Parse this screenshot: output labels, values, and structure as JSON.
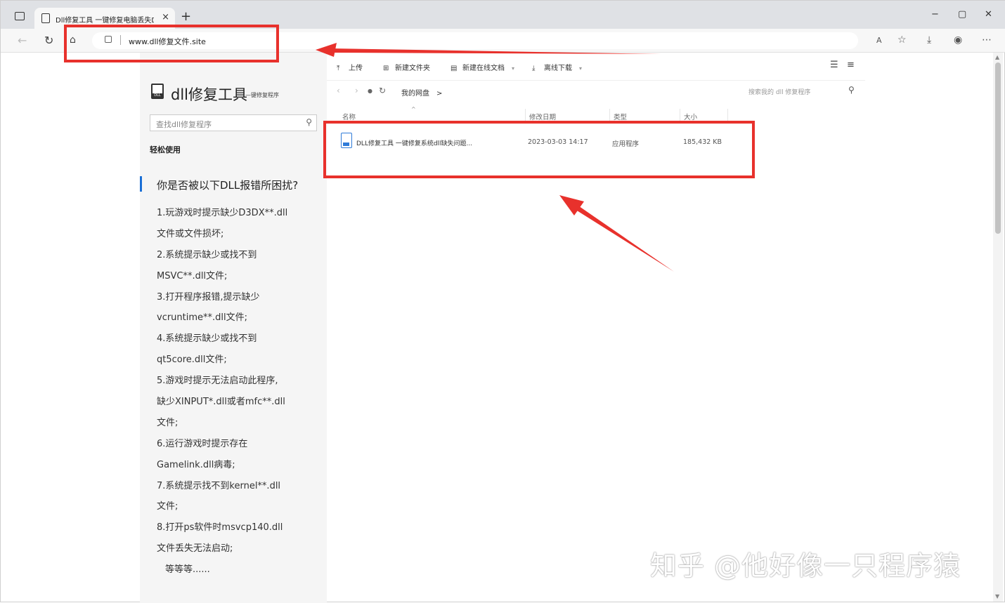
{
  "browser": {
    "tab_title": "Dll修复工具 一键修复电脑丢失D",
    "tab_close": "×",
    "new_tab": "+",
    "url": "www.dll修复文件.site",
    "window_controls": {
      "minimize": "−",
      "maximize": "▢",
      "close": "✕"
    }
  },
  "sidebar": {
    "logo_title": "dll修复工具",
    "logo_subtitle": "—键修复程序",
    "search_placeholder": "查找dll修复程序",
    "easy_use": "轻松使用",
    "heading": "你是否被以下DLL报错所困扰?",
    "lines": [
      "1.玩游戏时提示缺少D3DX**.dll",
      "文件或文件损坏;",
      "2.系统提示缺少或找不到",
      "MSVC**.dll文件;",
      "3.打开程序报错,提示缺少",
      "vcruntime**.dll文件;",
      "4.系统提示缺少或找不到",
      "qt5core.dll文件;",
      "5.游戏时提示无法启动此程序,",
      "缺少XINPUT*.dll或者mfc**.dll",
      "文件;",
      "6.运行游戏时提示存在",
      "Gamelink.dll病毒;",
      "7.系统提示找不到kernel**.dll",
      "文件;",
      "8.打开ps软件时msvcp140.dll",
      "文件丢失无法启动;",
      "等等等......"
    ]
  },
  "drive": {
    "toolbar": {
      "upload": "上传",
      "new_folder": "新建文件夹",
      "new_online_doc": "新建在线文档",
      "offline_download": "离线下载"
    },
    "path": "我的网盘",
    "path_sep": ">",
    "search_placeholder": "搜索我的 dll 修复程序",
    "columns": {
      "name": "名称",
      "modified": "修改日期",
      "type": "类型",
      "size": "大小"
    },
    "files": [
      {
        "name": "DLL修复工具 一键修复系统dll缺失问题...",
        "modified": "2023-03-03 14:17",
        "type": "应用程序",
        "size": "185,432 KB"
      }
    ]
  },
  "annotation_color": "#e8312c",
  "watermark": "知乎 @他好像一只程序猿"
}
